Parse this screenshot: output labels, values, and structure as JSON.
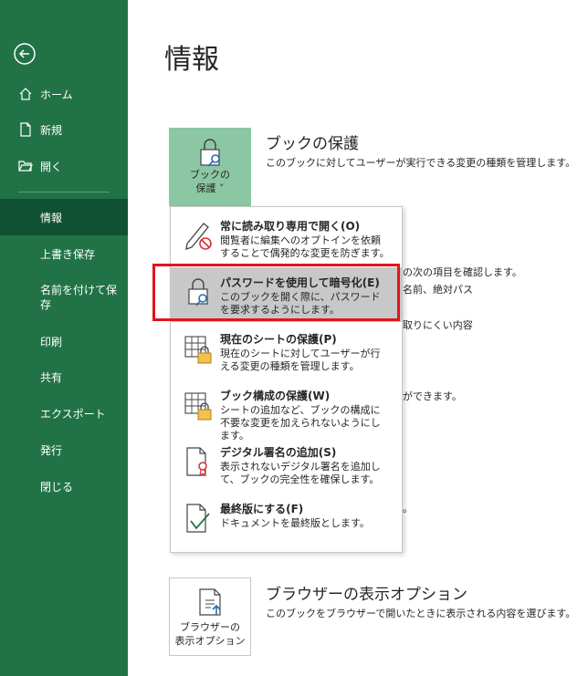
{
  "sidebar": {
    "items": [
      {
        "label": "ホーム",
        "icon": "home-icon"
      },
      {
        "label": "新規",
        "icon": "new-file-icon"
      },
      {
        "label": "開く",
        "icon": "open-folder-icon"
      },
      {
        "label": "情報"
      },
      {
        "label": "上書き保存"
      },
      {
        "label": "名前を付けて保\n存"
      },
      {
        "label": "印刷"
      },
      {
        "label": "共有"
      },
      {
        "label": "エクスポート"
      },
      {
        "label": "発行"
      },
      {
        "label": "閉じる"
      }
    ],
    "active": "情報",
    "background": "#217346",
    "active_background": "#0f5132"
  },
  "page": {
    "title": "情報"
  },
  "protect": {
    "tile_label": "ブックの\n保護 ˅",
    "title": "ブックの保護",
    "desc": "このブックに対してユーザーが実行できる変更の種類を管理します。"
  },
  "background_fragments": [
    "の次の項目を確認します。",
    "名前、絶対パス",
    "取りにくい内容",
    "ができます。",
    "。"
  ],
  "menu": {
    "items": [
      {
        "title": "常に読み取り専用で開く(O)",
        "desc": "閲覧者に編集へのオプトインを依頼することで偶発的な変更を防ぎます。",
        "icon": "pencil-no-icon"
      },
      {
        "title": "パスワードを使用して暗号化(E)",
        "desc": "このブックを開く際に、パスワードを要求するようにします。",
        "icon": "lock-key-icon"
      },
      {
        "title": "現在のシートの保護(P)",
        "desc": "現在のシートに対してユーザーが行える変更の種類を管理します。",
        "icon": "sheet-lock-icon"
      },
      {
        "title": "ブック構成の保護(W)",
        "desc": "シートの追加など、ブックの構成に不要な変更を加えられないようにします。",
        "icon": "workbook-lock-icon"
      },
      {
        "title": "デジタル署名の追加(S)",
        "desc": "表示されないデジタル署名を追加して、ブックの完全性を確保します。",
        "icon": "signature-icon"
      },
      {
        "title": "最終版にする(F)",
        "desc": "ドキュメントを最終版とします。",
        "icon": "final-check-icon"
      }
    ],
    "highlighted": "パスワードを使用して暗号化(E)"
  },
  "browser": {
    "tile_label": "ブラウザーの\n表示オプション",
    "title": "ブラウザーの表示オプション",
    "desc": "このブックをブラウザーで開いたときに表示される内容を選びます。"
  },
  "colors": {
    "highlight_box": "#e3141b",
    "tile_green": "#8cc7a3"
  }
}
